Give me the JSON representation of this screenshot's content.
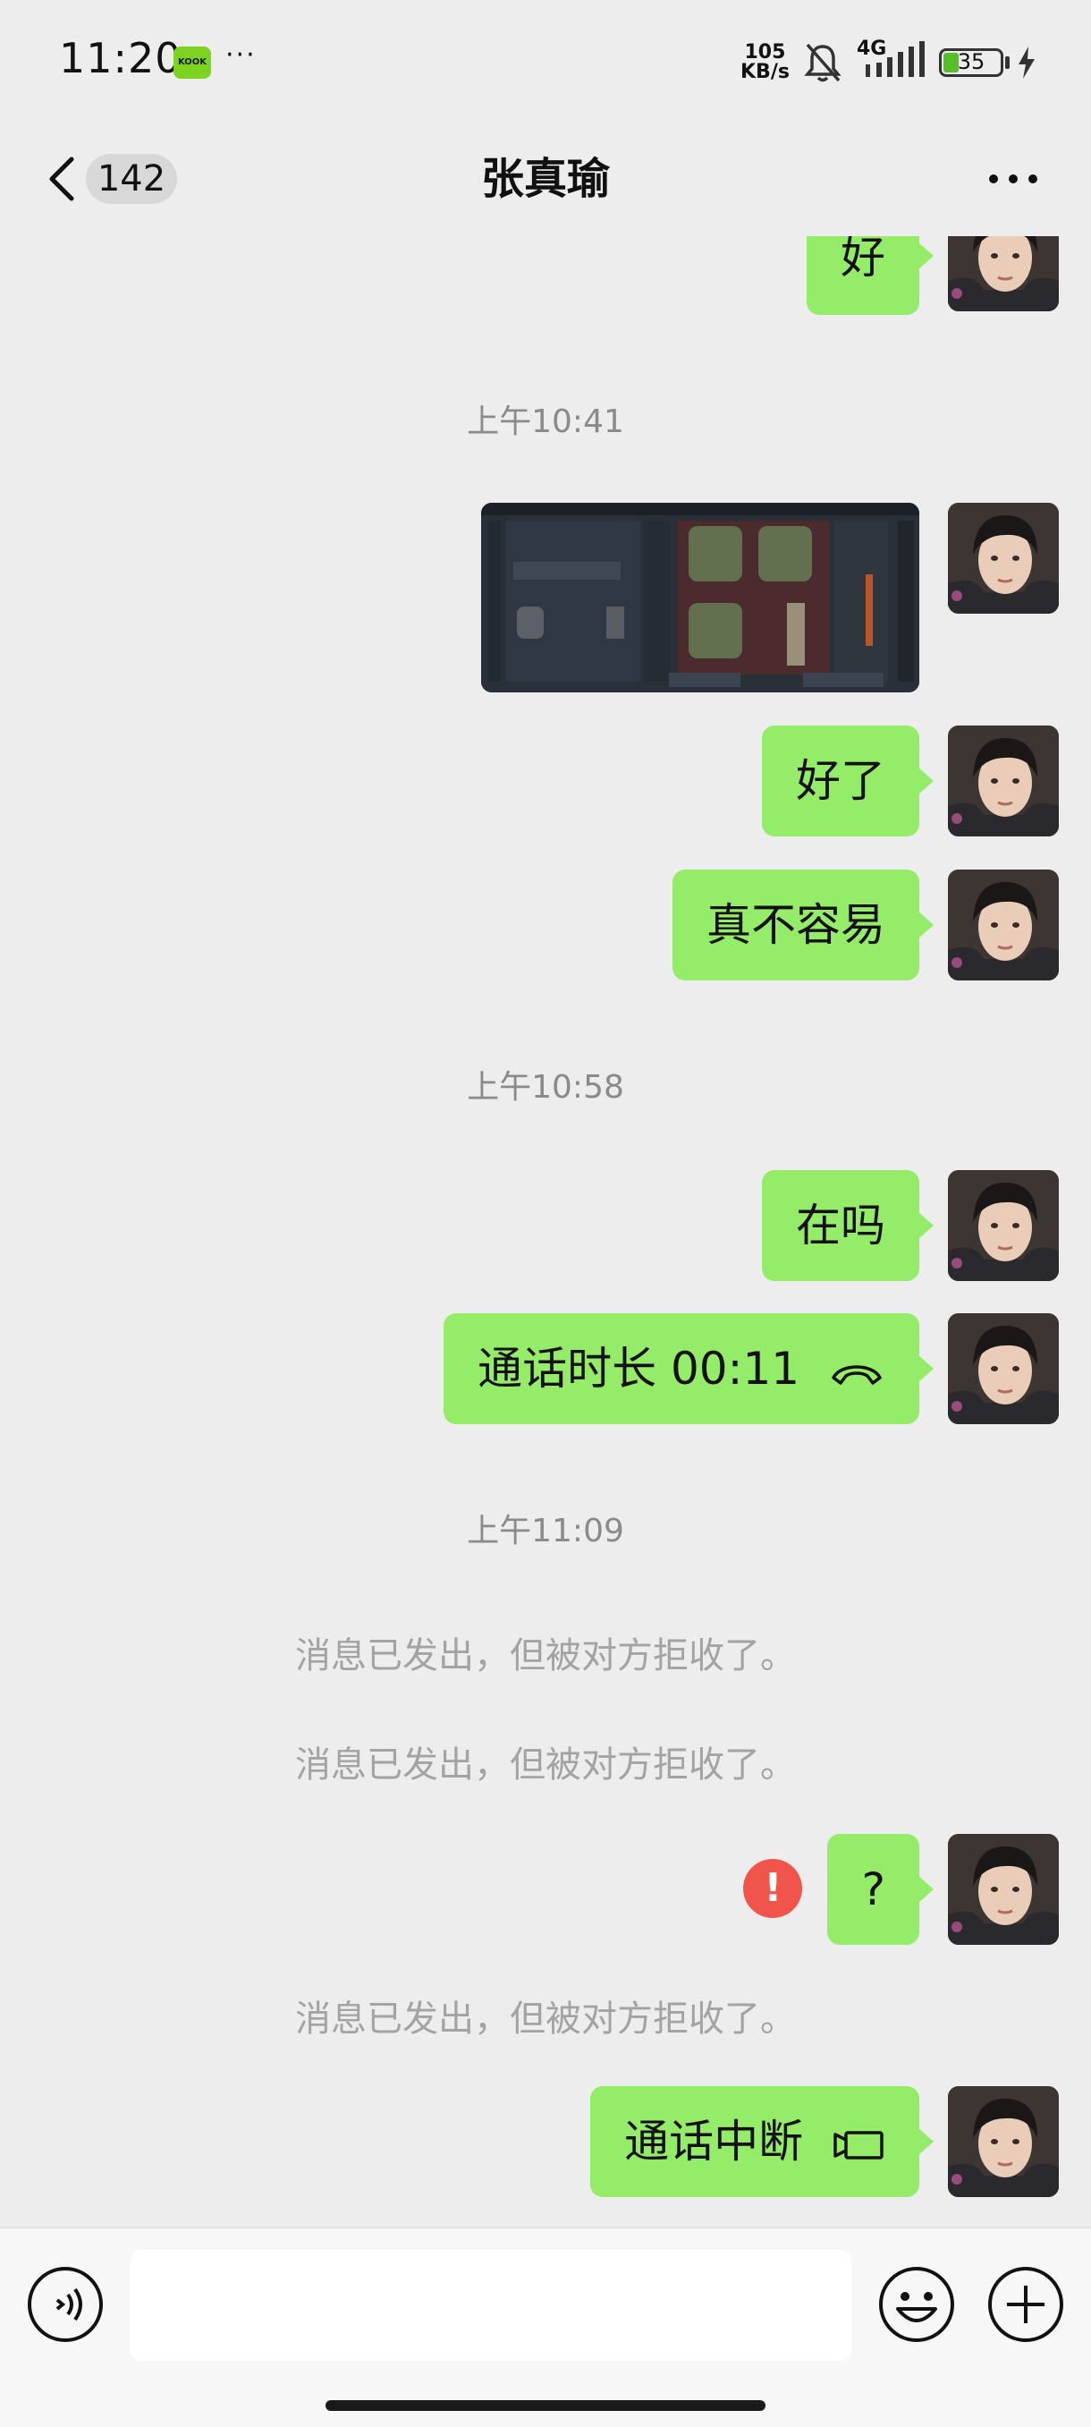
{
  "status_bar": {
    "time": "11:20",
    "app_icon": "KOOK",
    "overflow": "···",
    "net_speed_value": "105",
    "net_speed_unit": "KB/s",
    "network_type": "4G",
    "battery": "35"
  },
  "nav": {
    "unread_count": "142",
    "title": "张真瑜"
  },
  "messages": {
    "m1": "好",
    "ts1": "上午10:41",
    "m3": "好了",
    "m4": "真不容易",
    "ts2": "上午10:58",
    "m5": "在吗",
    "m6": "通话时长 00:11",
    "ts3": "上午11:09",
    "sys1": "消息已发出，但被对方拒收了。",
    "sys2": "消息已发出，但被对方拒收了。",
    "m7": "?",
    "error_mark": "!",
    "sys3": "消息已发出，但被对方拒收了。",
    "m8": "通话中断"
  },
  "colors": {
    "bubble_green": "#95ec69",
    "background": "#ededed",
    "error_red": "#f0554c"
  }
}
